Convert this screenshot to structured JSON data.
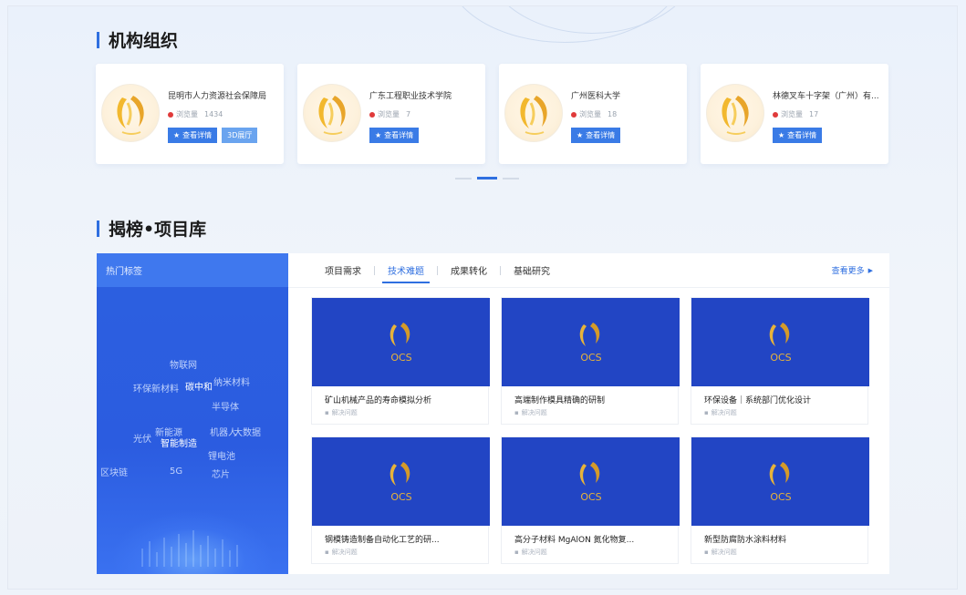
{
  "sections": {
    "orgs_title": "机构组织",
    "projects_title": "揭榜•项目库"
  },
  "orgs": [
    {
      "name": "昆明市人力资源社会保障局",
      "views_label": "浏览量",
      "views": "1434",
      "detail_label": "查看详情",
      "extra_label": "3D展厅"
    },
    {
      "name": "广东工程职业技术学院",
      "views_label": "浏览量",
      "views": "7",
      "detail_label": "查看详情"
    },
    {
      "name": "广州医科大学",
      "views_label": "浏览量",
      "views": "18",
      "detail_label": "查看详情"
    },
    {
      "name": "林德叉车十字架（广州）有...",
      "views_label": "浏览量",
      "views": "17",
      "detail_label": "查看详情"
    }
  ],
  "hot": {
    "header": "热门标签",
    "tags": [
      "物联网",
      "环保新材料",
      "碳中和",
      "纳米材料",
      "半导体",
      "光伏",
      "新能源",
      "智能制造",
      "机器人",
      "大数据",
      "锂电池",
      "区块链",
      "5G",
      "芯片"
    ]
  },
  "projects": {
    "tabs": [
      "项目需求",
      "技术难题",
      "成果转化",
      "基础研究"
    ],
    "active_tab": "技术难题",
    "more_label": "查看更多",
    "logo_text": "OCS",
    "items": [
      {
        "title": "矿山机械产品的寿命模拟分析",
        "sub": "解决问题"
      },
      {
        "title": "高端制作模具精确的研制",
        "sub": "解决问题"
      },
      {
        "title": "环保设备｜系统部门优化设计",
        "sub": "解决问题"
      },
      {
        "title": "钢模铸造制备自动化工艺的研...",
        "sub": "解决问题"
      },
      {
        "title": "高分子材料 MgAlON 氮化物复...",
        "sub": "解决问题"
      },
      {
        "title": "新型防腐防水涂料材料",
        "sub": "解决问题"
      }
    ]
  },
  "colors": {
    "accent": "#2f6fe0",
    "panel_blue": "#2b5ce0",
    "card_blue": "#2245c4",
    "gold": "#e7b33a"
  }
}
